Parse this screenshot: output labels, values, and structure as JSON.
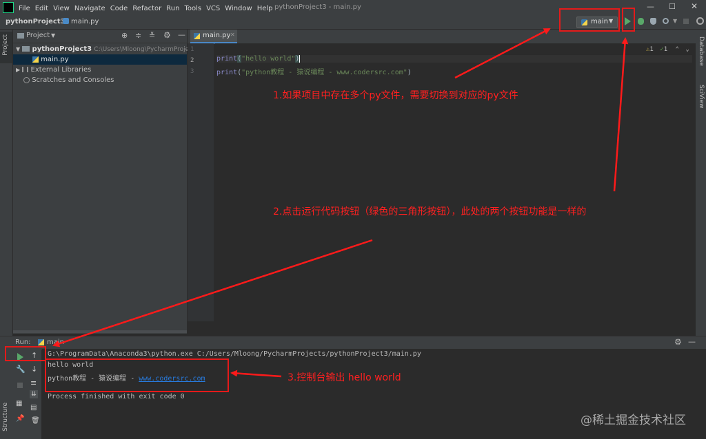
{
  "window": {
    "title": "pythonProject3 - main.py",
    "menu": [
      "File",
      "Edit",
      "View",
      "Navigate",
      "Code",
      "Refactor",
      "Run",
      "Tools",
      "VCS",
      "Window",
      "Help"
    ]
  },
  "navbar": {
    "project": "pythonProject3",
    "file": "main.py"
  },
  "run_config": {
    "label": "main"
  },
  "sidebar": {
    "left_tab": "Project",
    "bottom_tab": "Structure",
    "right_tabs": [
      "Database",
      "SciView"
    ]
  },
  "project_panel": {
    "title": "Project",
    "root_name": "pythonProject3",
    "root_path": "C:\\Users\\Mloong\\PycharmProjects\\",
    "file": "main.py",
    "items": [
      "External Libraries",
      "Scratches and Consoles"
    ]
  },
  "editor": {
    "tab": "main.py",
    "line_numbers": [
      "1",
      "2",
      "3"
    ],
    "line1": {
      "fn": "print",
      "arg": "\"hello world\""
    },
    "line2": {
      "fn": "print",
      "arg": "\"python教程 - 猿说编程 - www.codersrc.com\""
    },
    "inspection": {
      "warnings": "1",
      "checks": "1"
    }
  },
  "run_panel": {
    "label": "Run:",
    "tab": "main",
    "lines": [
      "G:\\ProgramData\\Anaconda3\\python.exe C:/Users/Mloong/PycharmProjects/pythonProject3/main.py",
      "hello world"
    ],
    "line3_prefix": "python教程 - 猿说编程 - ",
    "line3_link": "www.codersrc.com",
    "exit": "Process finished with exit code 0"
  },
  "annotations": {
    "a1": "1.如果项目中存在多个py文件，需要切换到对应的py文件",
    "a2": "2.点击运行代码按钮（绿色的三角形按钮），此处的两个按钮功能是一样的",
    "a3": "3.控制台输出 hello world",
    "annotation_color": "#ff1a1a"
  },
  "watermark": "@稀土掘金技术社区"
}
